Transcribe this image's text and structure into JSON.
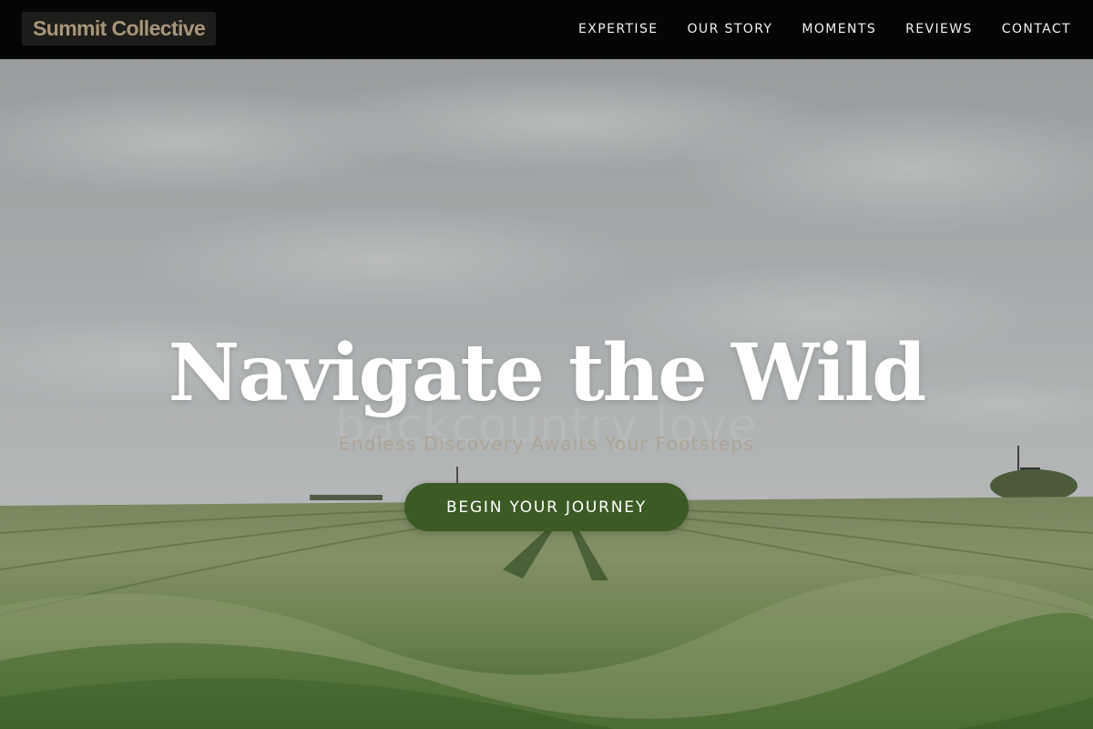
{
  "brand": {
    "name": "Summit Collective"
  },
  "nav": {
    "items": [
      {
        "label": "EXPERTISE"
      },
      {
        "label": "OUR STORY"
      },
      {
        "label": "MOMENTS"
      },
      {
        "label": "REVIEWS"
      },
      {
        "label": "CONTACT"
      }
    ]
  },
  "hero": {
    "title": "Navigate the Wild",
    "watermark": "backcountry love",
    "subtitle": "Endless Discovery Awaits Your Footsteps",
    "cta_label": "BEGIN YOUR JOURNEY"
  },
  "colors": {
    "header_bg": "#050505",
    "logo_bg": "#1d1d1b",
    "logo_text": "#a8957a",
    "cta_bg": "#3b5a24",
    "title": "#ffffff"
  }
}
